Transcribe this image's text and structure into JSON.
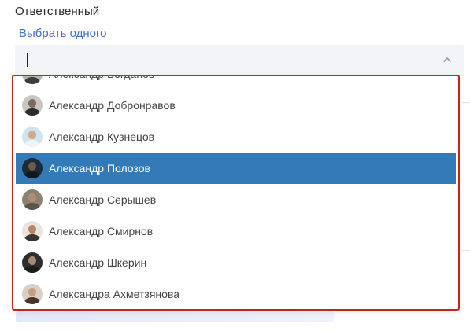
{
  "field": {
    "label": "Ответственный",
    "link_label": "Выбрать одного",
    "input_value": ""
  },
  "dropdown": {
    "border_color": "#c0281f",
    "highlight_color": "#337ab7",
    "options": [
      {
        "label": "Александр Богданов",
        "avatar": {
          "bg": "#b9b0a6",
          "head": "#8a6a55",
          "body": "#3c3c3c"
        },
        "highlighted": false
      },
      {
        "label": "Александр Добронравов",
        "avatar": {
          "bg": "#c9c6c2",
          "head": "#7d6a5e",
          "body": "#2b2b2b"
        },
        "highlighted": false
      },
      {
        "label": "Александр Кузнецов",
        "avatar": {
          "bg": "#cfe3f0",
          "head": "#d2a88a",
          "body": "#f2f2f2"
        },
        "highlighted": false
      },
      {
        "label": "Александр Полозов",
        "avatar": {
          "bg": "#1d2a38",
          "head": "#6d5a4f",
          "body": "#101820"
        },
        "highlighted": true
      },
      {
        "label": "Александр Серышев",
        "avatar": {
          "bg": "#8c8272",
          "head": "#b08d74",
          "body": "#5e5548"
        },
        "highlighted": false
      },
      {
        "label": "Александр Смирнов",
        "avatar": {
          "bg": "#e8e4df",
          "head": "#b88566",
          "body": "#3a3430"
        },
        "highlighted": false
      },
      {
        "label": "Александр Шкерин",
        "avatar": {
          "bg": "#2e2e2e",
          "head": "#a88a72",
          "body": "#1c1c1c"
        },
        "highlighted": false
      },
      {
        "label": "Александра Ахметзянова",
        "avatar": {
          "bg": "#d9cfc6",
          "head": "#c99d82",
          "body": "#4a3326"
        },
        "highlighted": false
      }
    ]
  }
}
